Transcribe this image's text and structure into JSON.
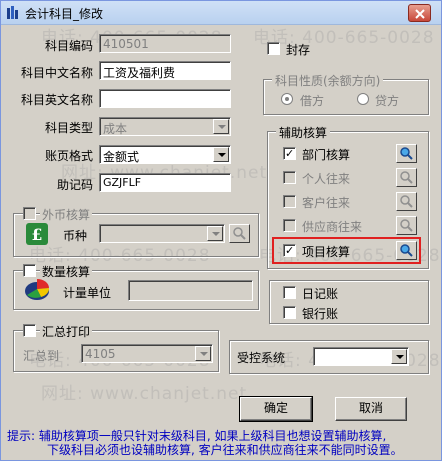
{
  "window": {
    "title": "会计科目_修改"
  },
  "fields": {
    "code_label": "科目编码",
    "code_value": "410501",
    "cn_name_label": "科目中文名称",
    "cn_name_value": "工资及福利费",
    "en_name_label": "科目英文名称",
    "en_name_value": "",
    "type_label": "科目类型",
    "type_value": "成本",
    "ledger_label": "账页格式",
    "ledger_value": "金额式",
    "mnemonic_label": "助记码",
    "mnemonic_value": "GZJFLF"
  },
  "seal": {
    "label": "封存",
    "checked": false
  },
  "nature": {
    "title": "科目性质(余额方向)",
    "debit_label": "借方",
    "credit_label": "贷方",
    "selected": "借方"
  },
  "aux": {
    "title": "辅助核算",
    "items": [
      {
        "label": "部门核算",
        "checked": true,
        "enabled": true
      },
      {
        "label": "个人往来",
        "checked": false,
        "enabled": false
      },
      {
        "label": "客户往来",
        "checked": false,
        "enabled": false
      },
      {
        "label": "供应商往来",
        "checked": false,
        "enabled": false
      },
      {
        "label": "项目核算",
        "checked": true,
        "enabled": true
      }
    ]
  },
  "foreign": {
    "title": "外币核算",
    "currency_label": "币种",
    "currency_value": ""
  },
  "quantity": {
    "title": "数量核算",
    "unit_label": "计量单位",
    "unit_value": ""
  },
  "summary": {
    "title": "汇总打印",
    "to_label": "汇总到",
    "to_value": "4105"
  },
  "books": {
    "journal_label": "日记账",
    "bank_label": "银行账"
  },
  "controlled": {
    "label": "受控系统",
    "value": ""
  },
  "buttons": {
    "ok": "确定",
    "cancel": "取消"
  },
  "hint": {
    "line1": "提示: 辅助核算项一般只针对末级科目, 如果上级科目也想设置辅助核算,",
    "line2": "下级科目必须也设辅助核算, 客户往来和供应商往来不能同时设置。"
  },
  "watermark": {
    "phone": "电话: 400-665-0028",
    "site": "网址: www.chanjet.net"
  },
  "colors": {
    "hint": "#0000c0",
    "highlight_box": "#e02020",
    "window_bg": "#d4d0c8"
  },
  "icons": {
    "window": "app-icon",
    "close": "close-icon",
    "search": "search-icon",
    "currency": "pound-currency-icon",
    "quantity": "pie-chart-icon"
  }
}
